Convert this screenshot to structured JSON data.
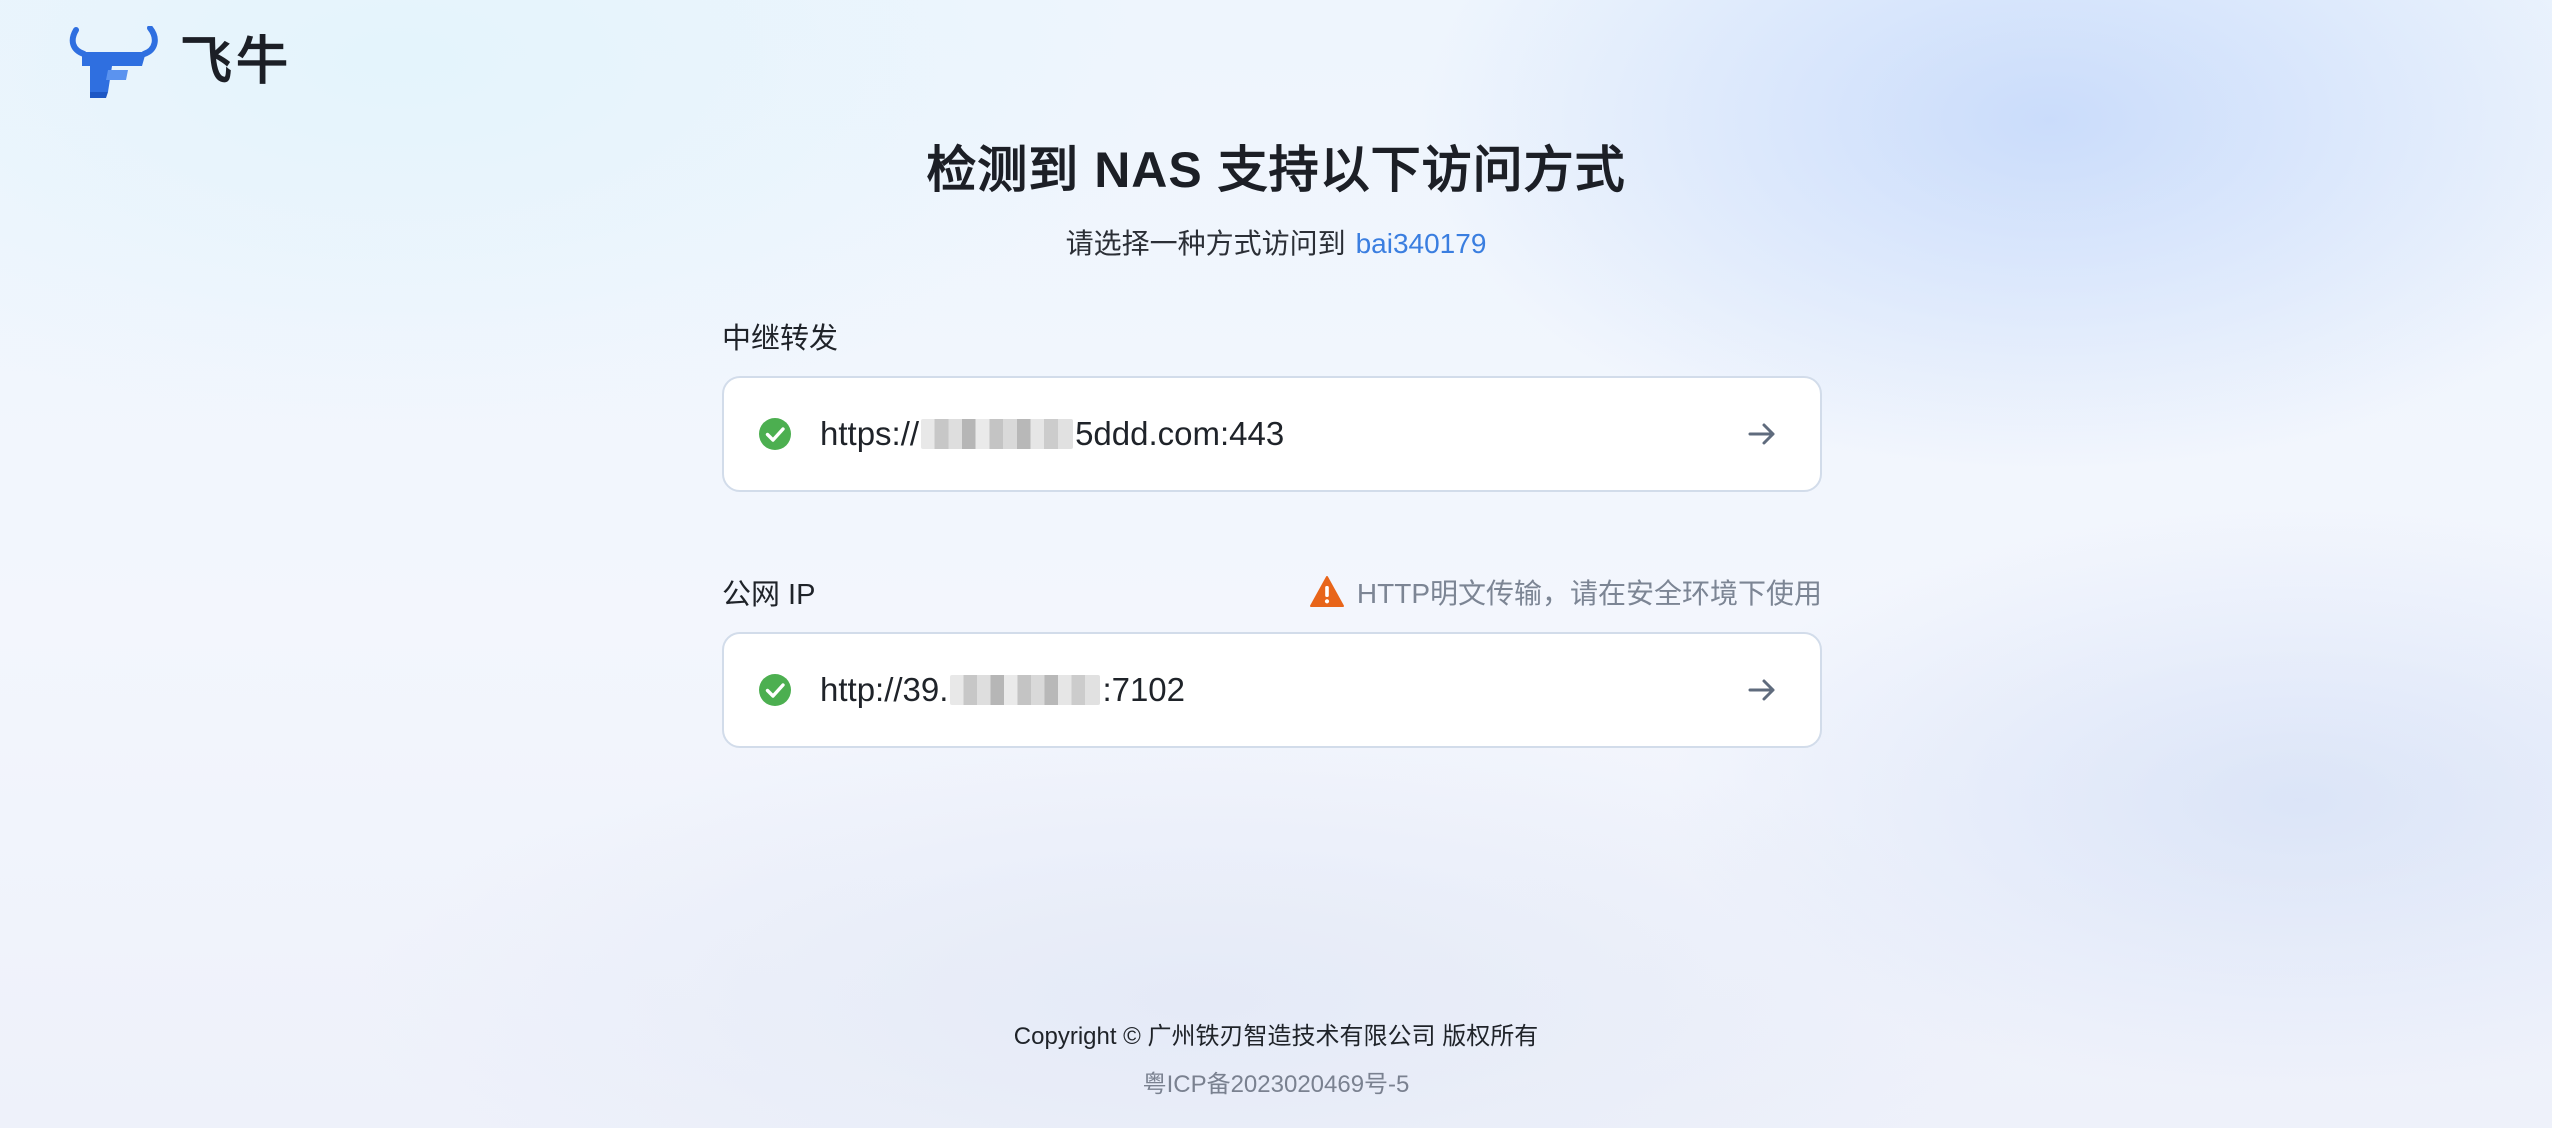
{
  "brand": {
    "name": "飞牛",
    "logo_icon": "fnos-bull-logo-icon",
    "accent_color": "#2f6fe0"
  },
  "header": {
    "title": "检测到 NAS 支持以下访问方式",
    "subtitle_prefix": "请选择一种方式访问到",
    "device_name": "bai340179"
  },
  "access_methods": [
    {
      "label": "中继转发",
      "status_icon": "check-circle-icon",
      "status_color": "#4caf50",
      "url_prefix": "https://",
      "url_suffix": "5ddd.com:443",
      "url_redacted": true,
      "action_icon": "arrow-right-icon"
    },
    {
      "label": "公网 IP",
      "warning_icon": "warning-triangle-icon",
      "warning_color": "#e8651a",
      "warning_text": "HTTP明文传输，请在安全环境下使用",
      "status_icon": "check-circle-icon",
      "status_color": "#4caf50",
      "url_prefix": "http://39.",
      "url_suffix": ":7102",
      "url_redacted": true,
      "action_icon": "arrow-right-icon"
    }
  ],
  "footer": {
    "copyright": "Copyright © 广州铁刃智造技术有限公司 版权所有",
    "icp": "粤ICP备2023020469号-5"
  }
}
